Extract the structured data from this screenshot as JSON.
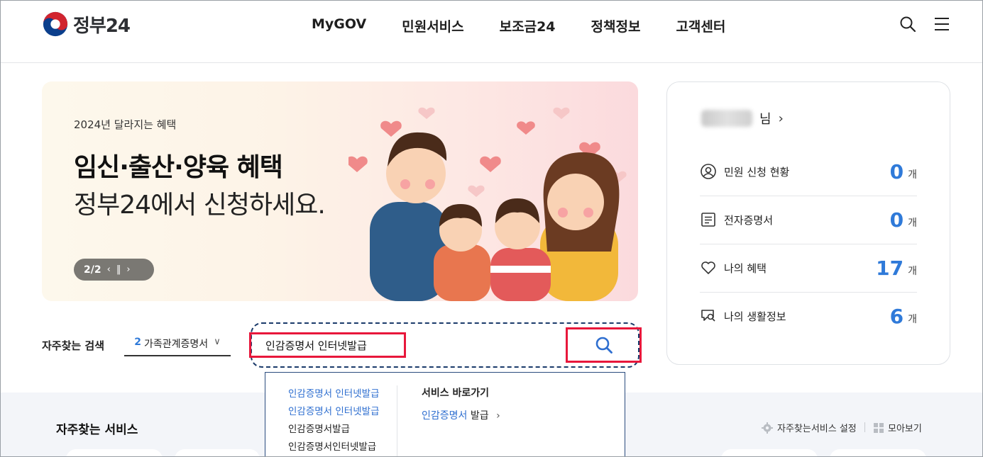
{
  "header": {
    "logo_text": "정부24",
    "nav": [
      "MyGOV",
      "민원서비스",
      "보조금24",
      "정책정보",
      "고객센터"
    ]
  },
  "banner": {
    "subtitle": "2024년 달라지는 혜택",
    "title": "임신·출산·양육 혜택",
    "desc": "정부24에서 신청하세요.",
    "page": "2/2"
  },
  "profile": {
    "name_suffix": "님",
    "stats": [
      {
        "icon": "user-circle-icon",
        "label": "민원 신청 현황",
        "value": "0",
        "unit": "개"
      },
      {
        "icon": "document-list-icon",
        "label": "전자증명서",
        "value": "0",
        "unit": "개"
      },
      {
        "icon": "heart-icon",
        "label": "나의 혜택",
        "value": "17",
        "unit": "개"
      },
      {
        "icon": "search-chat-icon",
        "label": "나의 생활정보",
        "value": "6",
        "unit": "개"
      }
    ]
  },
  "search": {
    "label": "자주찾는 검색",
    "keyword_rank": "2",
    "keyword": "가족관계증명서",
    "input_value": "인감증명서 인터넷발급"
  },
  "autocomplete": {
    "items": [
      {
        "text": "인감증명서 인터넷발급",
        "highlight": true
      },
      {
        "text": "인감증명서 인터넷발급",
        "highlight": true
      },
      {
        "text": "인감증명서발급",
        "highlight": false
      },
      {
        "text": "인감증명서인터넷발급",
        "highlight": false
      }
    ],
    "shortcut_title": "서비스 바로가기",
    "shortcut_link_bold": "인감증명서",
    "shortcut_link_rest": " 발급",
    "shortcut_arrow": "›"
  },
  "services": {
    "title": "자주찾는 서비스",
    "setting_label": "자주찾는서비스 설정",
    "view_all_label": "모아보기"
  },
  "colors": {
    "accent": "#2f7ad9",
    "highlight_border": "#e8173b",
    "search_border": "#1a3a6a"
  }
}
